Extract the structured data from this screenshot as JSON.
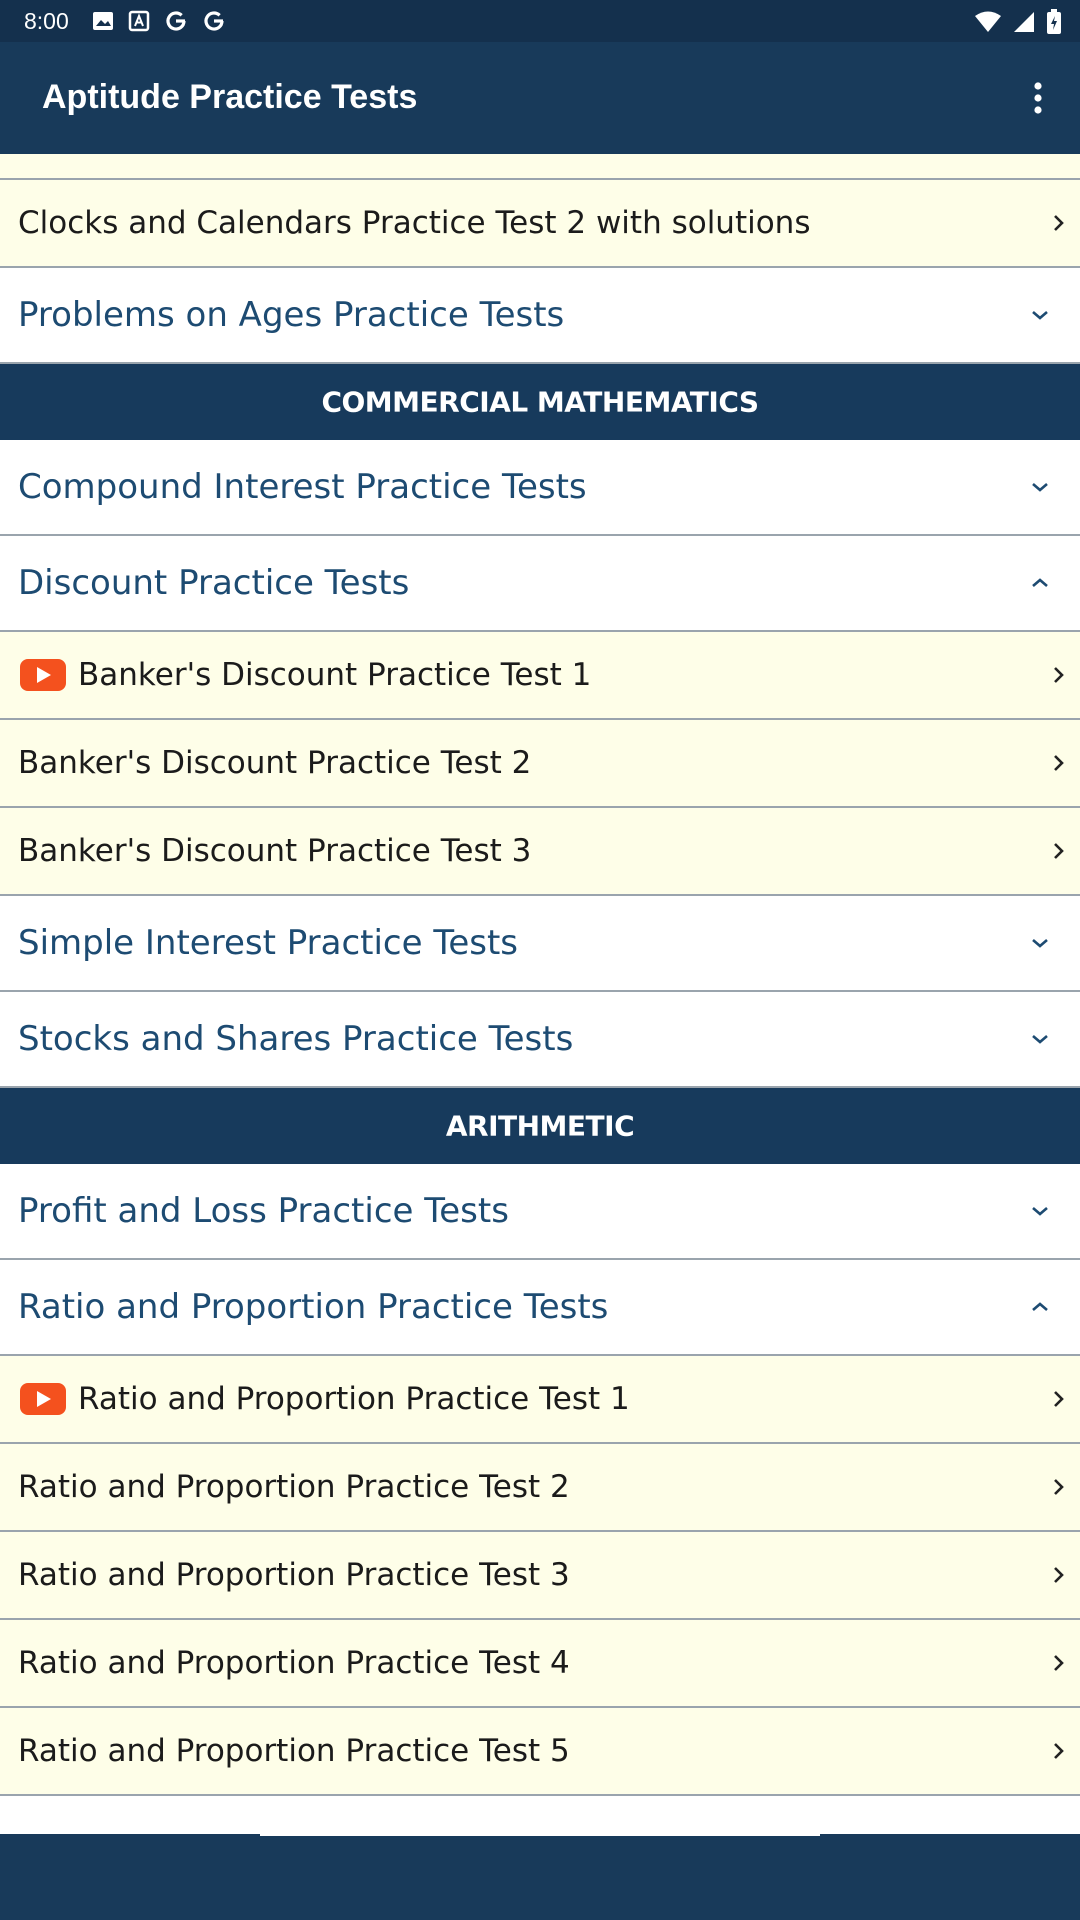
{
  "status_bar": {
    "time": "8:00",
    "left_icons": [
      "image-icon",
      "a-box-icon",
      "google-g-icon",
      "google-g-icon"
    ],
    "right_icons": [
      "wifi-icon",
      "signal-icon",
      "battery-icon"
    ]
  },
  "app_bar": {
    "title": "Aptitude Practice Tests",
    "menu_icon": "more-vert-icon"
  },
  "list": {
    "rows": [
      {
        "type": "test",
        "label": "Clocks and Calendars Practice Test 2 with solutions",
        "video": false
      },
      {
        "type": "topic",
        "label": "Problems on Ages Practice Tests",
        "expanded": false
      },
      {
        "type": "heading",
        "label": "COMMERCIAL MATHEMATICS"
      },
      {
        "type": "topic",
        "label": "Compound Interest Practice Tests",
        "expanded": false
      },
      {
        "type": "topic",
        "label": "Discount Practice Tests",
        "expanded": true
      },
      {
        "type": "test",
        "label": "Banker's Discount Practice Test 1",
        "video": true
      },
      {
        "type": "test",
        "label": "Banker's Discount Practice Test 2",
        "video": false
      },
      {
        "type": "test",
        "label": "Banker's Discount Practice Test 3",
        "video": false
      },
      {
        "type": "topic",
        "label": "Simple Interest Practice Tests",
        "expanded": false
      },
      {
        "type": "topic",
        "label": "Stocks and Shares Practice Tests",
        "expanded": false
      },
      {
        "type": "heading",
        "label": "ARITHMETIC"
      },
      {
        "type": "topic",
        "label": "Profit and Loss Practice Tests",
        "expanded": false
      },
      {
        "type": "topic",
        "label": "Ratio and Proportion Practice Tests",
        "expanded": true
      },
      {
        "type": "test",
        "label": "Ratio and Proportion Practice Test 1",
        "video": true
      },
      {
        "type": "test",
        "label": "Ratio and Proportion Practice Test 2",
        "video": false
      },
      {
        "type": "test",
        "label": "Ratio and Proportion Practice Test 3",
        "video": false
      },
      {
        "type": "test",
        "label": "Ratio and Proportion Practice Test 4",
        "video": false
      },
      {
        "type": "test",
        "label": "Ratio and Proportion Practice Test 5",
        "video": false
      }
    ]
  },
  "colors": {
    "primary": "#183a5a",
    "heading_bg": "#173a5c",
    "test_row_bg": "#fefee8",
    "topic_text": "#1d4b72",
    "video_red": "#f4511e"
  }
}
